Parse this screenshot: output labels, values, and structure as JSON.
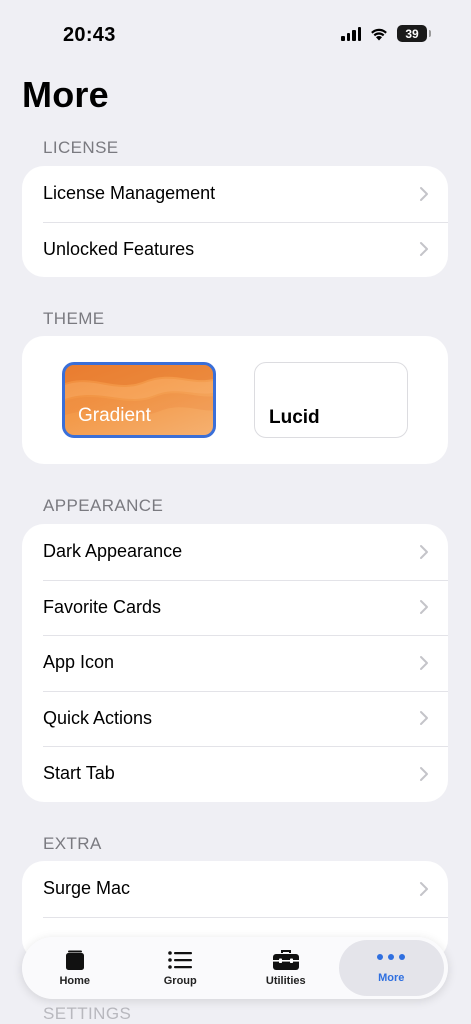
{
  "status": {
    "time": "20:43",
    "battery": "39"
  },
  "page": {
    "title": "More"
  },
  "sections": {
    "license": {
      "header": "LICENSE",
      "items": [
        "License Management",
        "Unlocked Features"
      ]
    },
    "theme": {
      "header": "THEME",
      "options": [
        "Gradient",
        "Lucid"
      ],
      "selected": "Gradient"
    },
    "appearance": {
      "header": "APPEARANCE",
      "items": [
        "Dark Appearance",
        "Favorite Cards",
        "App Icon",
        "Quick Actions",
        "Start Tab"
      ]
    },
    "extra": {
      "header": "EXTRA",
      "items": [
        "Surge Mac"
      ]
    },
    "settings": {
      "header": "SETTINGS"
    }
  },
  "tabbar": {
    "tabs": [
      {
        "label": "Home",
        "icon": "home-icon"
      },
      {
        "label": "Group",
        "icon": "list-icon"
      },
      {
        "label": "Utilities",
        "icon": "toolbox-icon"
      },
      {
        "label": "More",
        "icon": "more-dots-icon"
      }
    ],
    "active": "More"
  },
  "colors": {
    "accent": "#2f6fe0",
    "selection_border": "#3a6fd8",
    "gradient_theme": "#f08a3a"
  }
}
